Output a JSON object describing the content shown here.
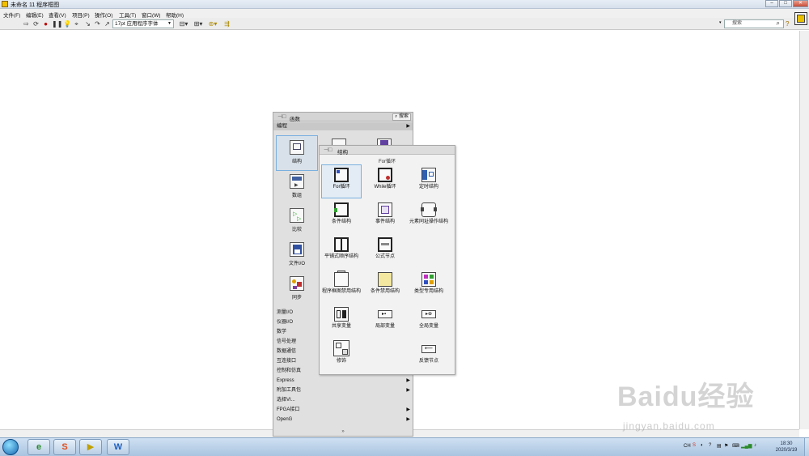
{
  "window": {
    "title": "未命名 11 程序框图",
    "controls": [
      "minimize-icon",
      "maximize-icon",
      "close-icon"
    ]
  },
  "menu": [
    "文件(F)",
    "编辑(E)",
    "查看(V)",
    "项目(P)",
    "操作(O)",
    "工具(T)",
    "窗口(W)",
    "帮助(H)"
  ],
  "toolbar": {
    "font_select": "17pt 应用程序字体",
    "search_placeholder": "搜索",
    "help_icon": "?"
  },
  "functions_palette": {
    "title": "函数",
    "search_label": "搜索",
    "category": "编程",
    "items": [
      {
        "label": "结构",
        "icon": "structure-icon"
      },
      {
        "label": "数组",
        "icon": "array-icon"
      },
      {
        "label": "比较",
        "icon": "compare-icon"
      },
      {
        "label": "文件I/O",
        "icon": "file-io-icon"
      },
      {
        "label": "同步",
        "icon": "sync-icon"
      }
    ],
    "categories": [
      {
        "label": "测量I/O",
        "submenu": true
      },
      {
        "label": "仪器I/O",
        "submenu": true
      },
      {
        "label": "数学",
        "submenu": true
      },
      {
        "label": "信号处理",
        "submenu": true
      },
      {
        "label": "数据通信",
        "submenu": true
      },
      {
        "label": "互连接口",
        "submenu": true
      },
      {
        "label": "控制和仿真",
        "submenu": true
      },
      {
        "label": "Express",
        "submenu": true
      },
      {
        "label": "附加工具包",
        "submenu": true
      },
      {
        "label": "选择VI...",
        "submenu": false
      },
      {
        "label": "FPGA接口",
        "submenu": true
      },
      {
        "label": "OpenG",
        "submenu": true
      }
    ],
    "more_symbol": "»"
  },
  "structures_palette": {
    "title": "结构",
    "tooltip": "For循环",
    "items": [
      {
        "label": "For循环",
        "icon": "for-loop-icon"
      },
      {
        "label": "While循环",
        "icon": "while-loop-icon"
      },
      {
        "label": "定时结构",
        "icon": "timed-structure-icon"
      },
      {
        "label": "条件结构",
        "icon": "case-structure-icon"
      },
      {
        "label": "事件结构",
        "icon": "event-structure-icon"
      },
      {
        "label": "元素同址操作结构",
        "icon": "in-place-element-icon"
      },
      {
        "label": "平铺式顺序结构",
        "icon": "flat-sequence-icon"
      },
      {
        "label": "公式节点",
        "icon": "formula-node-icon"
      },
      {
        "label": "",
        "icon": ""
      },
      {
        "label": "程序框图禁用结构",
        "icon": "diagram-disable-icon"
      },
      {
        "label": "条件禁用结构",
        "icon": "conditional-disable-icon"
      },
      {
        "label": "类型专用结构",
        "icon": "type-specialization-icon"
      },
      {
        "label": "共享变量",
        "icon": "shared-variable-icon"
      },
      {
        "label": "局部变量",
        "icon": "local-variable-icon"
      },
      {
        "label": "全局变量",
        "icon": "global-variable-icon"
      },
      {
        "label": "修饰",
        "icon": "decorations-icon"
      },
      {
        "label": "",
        "icon": ""
      },
      {
        "label": "反馈节点",
        "icon": "feedback-node-icon"
      }
    ]
  },
  "taskbar": {
    "apps": [
      "ie-icon",
      "sogou-icon",
      "labview-icon",
      "wps-icon"
    ],
    "tray_lang": "CH",
    "time": "18:30",
    "date": "2020/3/19"
  },
  "watermark": {
    "logo": "Baidu经验",
    "url": "jingyan.baidu.com"
  },
  "colors": {
    "palette_bg": "#e0e0e0",
    "subpalette_bg": "#f2f2f2",
    "selection": "#7ab0e0",
    "taskbar": "#a9c4e0"
  }
}
